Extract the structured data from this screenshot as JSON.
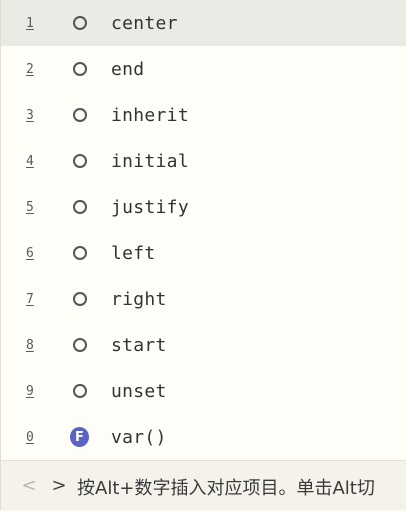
{
  "suggestions": [
    {
      "num": "1",
      "label": "center",
      "icon": "property-value-icon",
      "selected": true
    },
    {
      "num": "2",
      "label": "end",
      "icon": "property-value-icon"
    },
    {
      "num": "3",
      "label": "inherit",
      "icon": "property-value-icon"
    },
    {
      "num": "4",
      "label": "initial",
      "icon": "property-value-icon"
    },
    {
      "num": "5",
      "label": "justify",
      "icon": "property-value-icon"
    },
    {
      "num": "6",
      "label": "left",
      "icon": "property-value-icon"
    },
    {
      "num": "7",
      "label": "right",
      "icon": "property-value-icon"
    },
    {
      "num": "8",
      "label": "start",
      "icon": "property-value-icon"
    },
    {
      "num": "9",
      "label": "unset",
      "icon": "property-value-icon"
    },
    {
      "num": "0",
      "label": "var()",
      "icon": "function-icon",
      "icon_letter": "F"
    }
  ],
  "footer": {
    "prev_glyph": "<",
    "next_glyph": ">",
    "hint": "按Alt+数字插入对应项目。单击Alt切"
  },
  "colors": {
    "selected_row": "#ebebe6",
    "function_icon": "#5b63c8",
    "background": "#fffdf7"
  }
}
